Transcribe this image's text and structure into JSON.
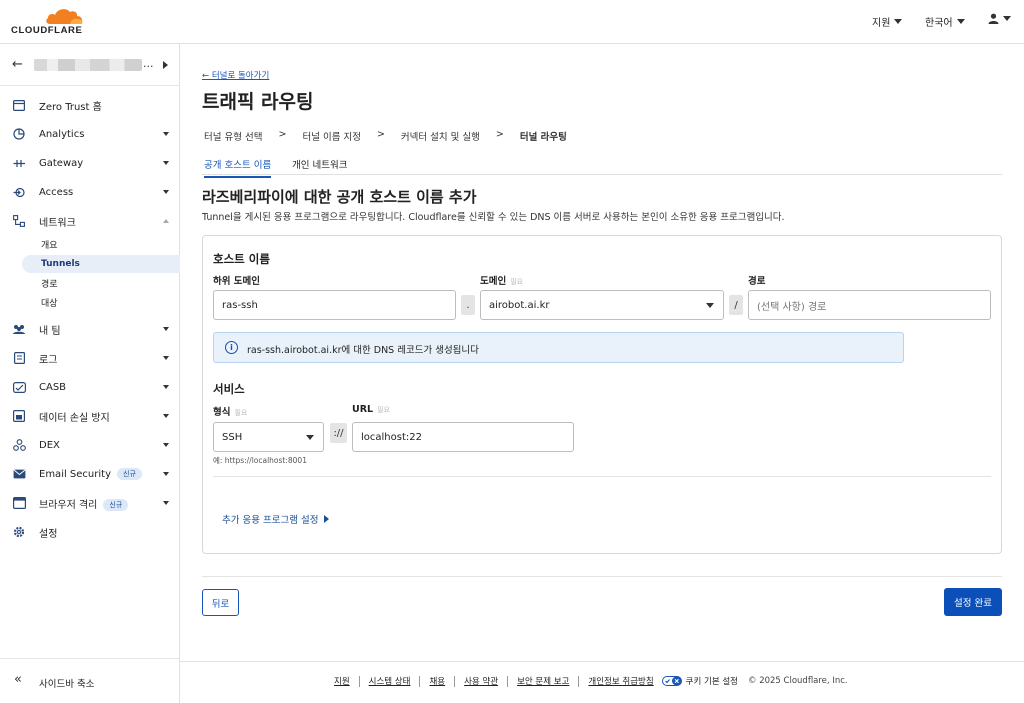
{
  "brand": {
    "name": "CLOUDFLARE",
    "accent": "#f38020"
  },
  "topbar": {
    "support": "지원",
    "language": "한국어"
  },
  "sidebar": {
    "account_suffix": "...",
    "items": [
      {
        "label": "Zero Trust 홈",
        "icon": "home-icon"
      },
      {
        "label": "Analytics",
        "icon": "analytics-icon"
      },
      {
        "label": "Gateway",
        "icon": "gateway-icon"
      },
      {
        "label": "Access",
        "icon": "access-icon"
      },
      {
        "label": "네트워크",
        "icon": "network-icon"
      },
      {
        "label": "내 팀",
        "icon": "team-icon"
      },
      {
        "label": "로그",
        "icon": "log-icon"
      },
      {
        "label": "CASB",
        "icon": "casb-icon"
      },
      {
        "label": "데이터 손실 방지",
        "icon": "dlp-icon"
      },
      {
        "label": "DEX",
        "icon": "dex-icon"
      },
      {
        "label": "Email Security",
        "icon": "email-icon",
        "badge": "신규"
      },
      {
        "label": "브라우저 격리",
        "icon": "browser-icon",
        "badge": "신규"
      },
      {
        "label": "설정",
        "icon": "settings-icon"
      }
    ],
    "network_sub": [
      "개요",
      "Tunnels",
      "경로",
      "대상"
    ],
    "collapse_label": "사이드바 축소"
  },
  "main": {
    "back_link": "← 터널로 돌아가기",
    "title": "트래픽 라우팅",
    "steps": [
      "터널 유형 선택",
      "터널 이름 지정",
      "커넥터 설치 및 실행",
      "터널 라우팅"
    ],
    "step_sep": ">",
    "tabs": [
      "공개 호스트 이름",
      "개인 네트워크"
    ],
    "section_title": "라즈베리파이에 대한 공개 호스트 이름 추가",
    "section_desc": "Tunnel을 게시된 응용 프로그램으로 라우팅합니다. Cloudflare를 신뢰할 수 있는 DNS 이름 서버로 사용하는 본인이 소유한 응용 프로그램입니다.",
    "hostname": {
      "heading": "호스트 이름",
      "subdomain_label": "하위 도메인",
      "subdomain_value": "ras-ssh",
      "dot": ".",
      "domain_label": "도메인",
      "required": "필요",
      "domain_value": "airobot.ai.kr",
      "slash": "/",
      "path_label": "경로",
      "path_placeholder": "(선택 사항) 경로",
      "info": "ras-ssh.airobot.ai.kr에 대한 DNS 레코드가 생성됩니다"
    },
    "service": {
      "heading": "서비스",
      "type_label": "형식",
      "type_value": "SSH",
      "sep": "://",
      "url_label": "URL",
      "url_value": "localhost:22",
      "hint": "예: https://localhost:8001"
    },
    "advanced": "추가 응용 프로그램 설정",
    "back_button": "뒤로",
    "done_button": "설정 완료"
  },
  "footer": {
    "links": [
      "지원",
      "시스템 상태",
      "채용",
      "사용 약관",
      "보안 문제 보고",
      "개인정보 취급방침"
    ],
    "cookie": "쿠키 기본 설정",
    "copyright": "© 2025 Cloudflare, Inc."
  }
}
